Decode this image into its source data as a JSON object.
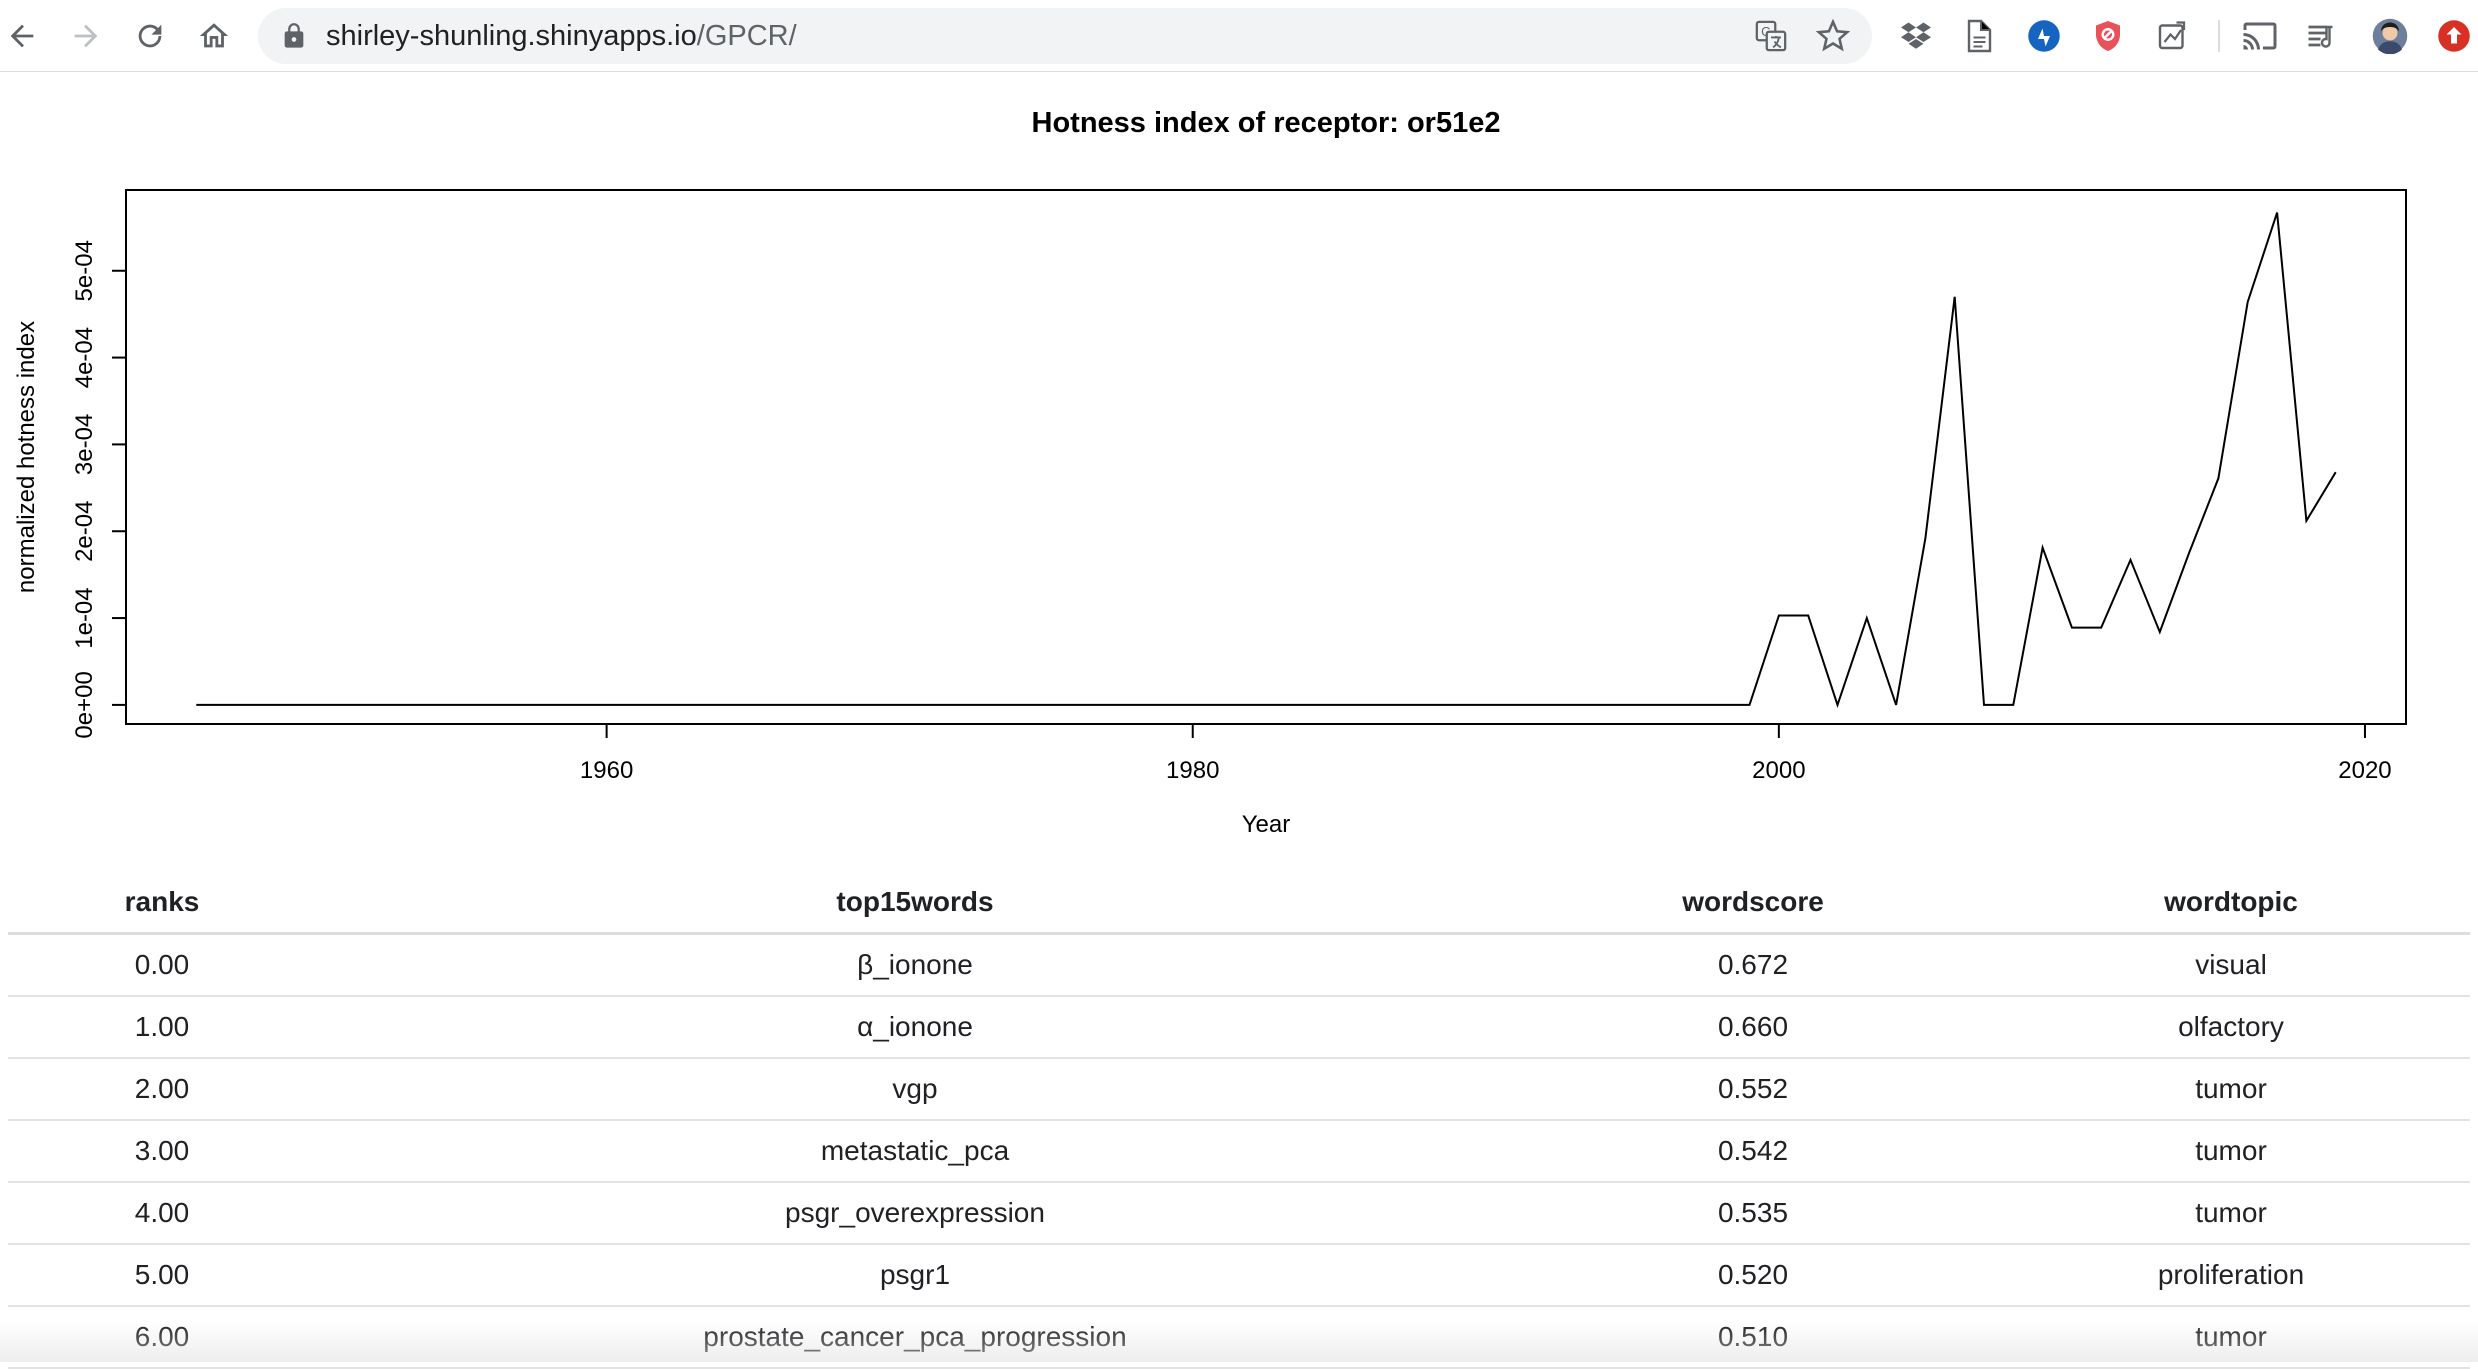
{
  "browser": {
    "url_host": "shirley-shunling.shinyapps.io",
    "url_path": "/GPCR/",
    "icons": [
      "back-icon",
      "forward-icon",
      "reload-icon",
      "home-icon",
      "lock-icon",
      "translate-icon",
      "star-icon",
      "dropbox-icon",
      "document-icon",
      "sync-icon",
      "shield-icon",
      "puzzle-icon",
      "cast-icon",
      "reading-list-icon",
      "avatar",
      "update-icon"
    ],
    "colors": {
      "accent_blue": "#1a73e8",
      "shield_red": "#e8525a",
      "update_red": "#d93025",
      "sync_blue": "#1565c0"
    }
  },
  "chart_data": {
    "type": "line",
    "title": "Hotness index of receptor:  or51e2",
    "xlabel": "Year",
    "ylabel": "normalized hotness index",
    "xlim": [
      1943.6,
      2021.4
    ],
    "ylim": [
      -2.2e-05,
      0.000593
    ],
    "xticks": [
      1960,
      1980,
      2000,
      2020
    ],
    "xtick_labels": [
      "1960",
      "1980",
      "2000",
      "2020"
    ],
    "yticks": [
      0,
      0.0001,
      0.0002,
      0.0003,
      0.0004,
      0.0005
    ],
    "ytick_labels": [
      "0e+00",
      "1e-04",
      "2e-04",
      "3e-04",
      "4e-04",
      "5e-04"
    ],
    "grid": false,
    "legend": "none",
    "line_color": "#000000",
    "x": [
      1946,
      1999,
      2000,
      2001,
      2002,
      2003,
      2004,
      2005,
      2006,
      2007,
      2008,
      2009,
      2010,
      2011,
      2012,
      2013,
      2014,
      2015,
      2016,
      2017,
      2018,
      2019
    ],
    "y": [
      0,
      0,
      0.000103,
      0.000103,
      0,
      0.0001,
      0,
      0.000192,
      0.00047,
      0,
      0,
      0.000181,
      8.9e-05,
      8.9e-05,
      0.000167,
      8.4e-05,
      0.000175,
      0.000261,
      0.000464,
      0.000567,
      0.000212,
      0.000268
    ]
  },
  "table": {
    "columns": [
      "ranks",
      "top15words",
      "wordscore",
      "wordtopic"
    ],
    "rows": [
      [
        "0.00",
        "β_ionone",
        "0.672",
        "visual"
      ],
      [
        "1.00",
        "α_ionone",
        "0.660",
        "olfactory"
      ],
      [
        "2.00",
        "vgp",
        "0.552",
        "tumor"
      ],
      [
        "3.00",
        "metastatic_pca",
        "0.542",
        "tumor"
      ],
      [
        "4.00",
        "psgr_overexpression",
        "0.535",
        "tumor"
      ],
      [
        "5.00",
        "psgr1",
        "0.520",
        "proliferation"
      ],
      [
        "6.00",
        "prostate_cancer_pca_progression",
        "0.510",
        "tumor"
      ]
    ]
  }
}
